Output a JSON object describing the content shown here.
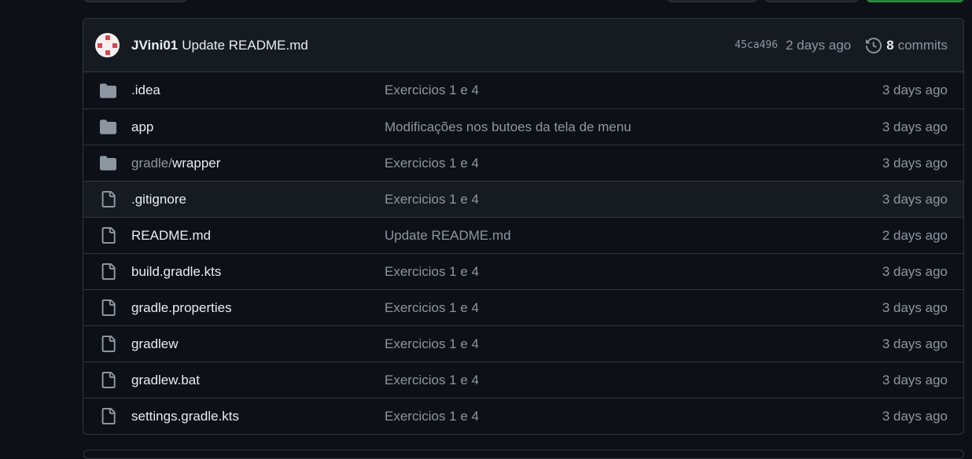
{
  "commit": {
    "author": "JVini01",
    "message": "Update README.md",
    "sha": "45ca496",
    "time": "2 days ago",
    "commit_count": "8",
    "commits_label": "commits"
  },
  "files": [
    {
      "type": "folder",
      "prefix": "",
      "name": ".idea",
      "message": "Exercicios 1 e 4",
      "age": "3 days ago"
    },
    {
      "type": "folder",
      "prefix": "",
      "name": "app",
      "message": "Modificações nos butoes da tela de menu",
      "age": "3 days ago"
    },
    {
      "type": "folder",
      "prefix": "gradle/",
      "name": "wrapper",
      "message": "Exercicios 1 e 4",
      "age": "3 days ago"
    },
    {
      "type": "file",
      "prefix": "",
      "name": ".gitignore",
      "message": "Exercicios 1 e 4",
      "age": "3 days ago"
    },
    {
      "type": "file",
      "prefix": "",
      "name": "README.md",
      "message": "Update README.md",
      "age": "2 days ago"
    },
    {
      "type": "file",
      "prefix": "",
      "name": "build.gradle.kts",
      "message": "Exercicios 1 e 4",
      "age": "3 days ago"
    },
    {
      "type": "file",
      "prefix": "",
      "name": "gradle.properties",
      "message": "Exercicios 1 e 4",
      "age": "3 days ago"
    },
    {
      "type": "file",
      "prefix": "",
      "name": "gradlew",
      "message": "Exercicios 1 e 4",
      "age": "3 days ago"
    },
    {
      "type": "file",
      "prefix": "",
      "name": "gradlew.bat",
      "message": "Exercicios 1 e 4",
      "age": "3 days ago"
    },
    {
      "type": "file",
      "prefix": "",
      "name": "settings.gradle.kts",
      "message": "Exercicios 1 e 4",
      "age": "3 days ago"
    }
  ],
  "icons": {
    "folder": "folder-icon",
    "file": "file-icon",
    "history": "history-icon"
  },
  "colors": {
    "background": "#0d1117",
    "border": "#30363d",
    "header_bg": "#161b22",
    "muted_text": "#8d96a0",
    "primary_text": "#e6edf3",
    "primary_button": "#238636"
  }
}
